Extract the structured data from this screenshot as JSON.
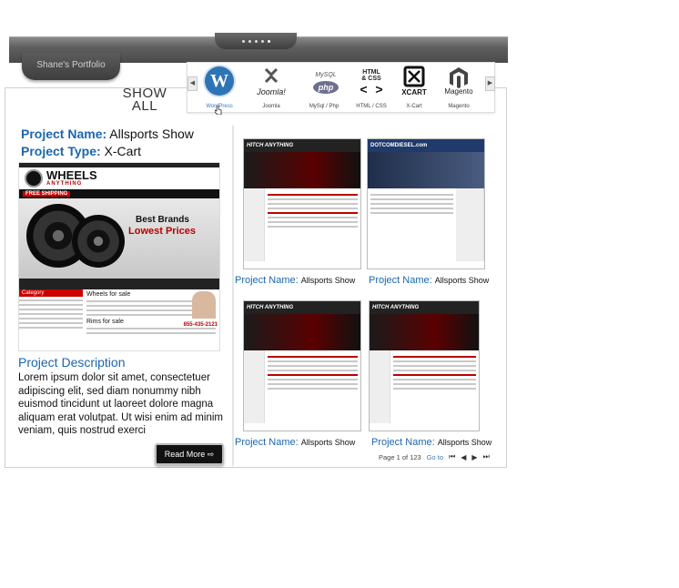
{
  "portfolio_tab": "Shane's Portfolio",
  "show_all": "SHOW ALL",
  "categories": [
    {
      "icon": "wordpress-icon",
      "label": "WordPress",
      "active": true
    },
    {
      "icon": "joomla-icon",
      "label": "Joomla",
      "art": "Joomla!"
    },
    {
      "icon": "mysql-php-icon",
      "label": "MySql / Php",
      "art": "MySQL php"
    },
    {
      "icon": "html-css-icon",
      "label": "HTML / CSS",
      "art": "HTML & CSS < >"
    },
    {
      "icon": "xcart-icon",
      "label": "X-Cart",
      "art": "XCART"
    },
    {
      "icon": "magento-icon",
      "label": "Magento",
      "art": "Magento"
    }
  ],
  "project": {
    "name_label": "Project Name:",
    "name": "Allsports Show",
    "type_label": "Project Type:",
    "type": "X-Cart",
    "desc_title": "Project Description",
    "description": "Lorem ipsum dolor sit amet, consectetuer adipiscing elit, sed diam nonummy nibh euismod tincidunt ut laoreet dolore magna aliquam erat volutpat. Ut wisi enim ad minim veniam, quis nostrud exerci",
    "read_more": "Read More"
  },
  "preview_site": {
    "brand": "WHEELS",
    "brand_sub": "ANYTHING",
    "promo": "FREE SHIPPING",
    "hero1": "Best Brands",
    "hero2": "Lowest Prices",
    "category": "Category",
    "wheels": "Wheels for sale",
    "rims": "Rims for sale",
    "phone": "855-435-2121"
  },
  "thumbnails": [
    {
      "label": "Project Name:",
      "name": "Allsports Show",
      "site": "HITCH ANYTHING"
    },
    {
      "label": "Project Name:",
      "name": "Allsports Show",
      "site": "DOTCOMDIESEL.com"
    },
    {
      "label": "Project Name:",
      "name": "Allsports Show",
      "site": "HITCH ANYTHING"
    },
    {
      "label": "Project Name:",
      "name": "Allsports Show",
      "site": "HITCH ANYTHING"
    }
  ],
  "pager": {
    "text": "Page 1 of 123",
    "goto": "Go to"
  },
  "colors": {
    "accent": "#1a66b3",
    "dark_bar": "#4a4a4a"
  }
}
